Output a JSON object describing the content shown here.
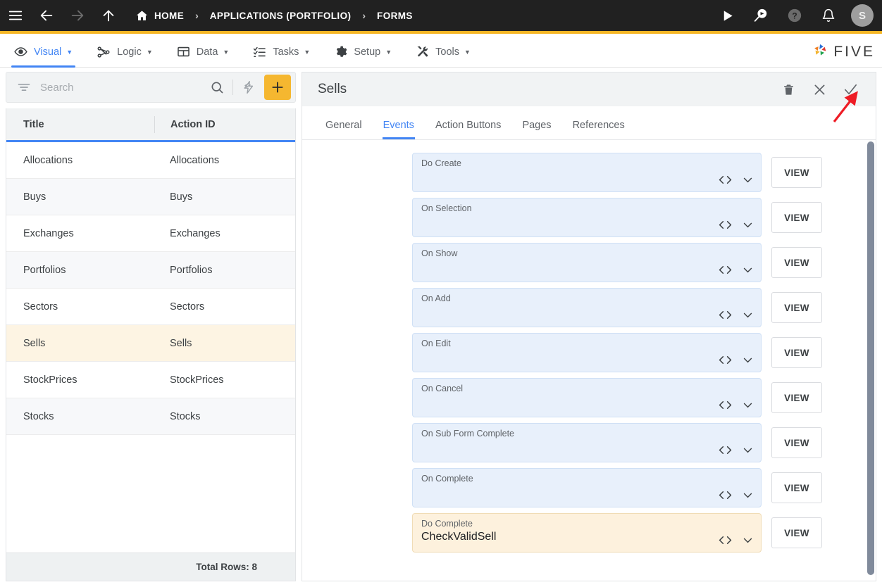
{
  "topbar": {
    "icons": [
      "menu-icon",
      "back-arrow-icon",
      "forward-arrow-icon",
      "up-arrow-icon"
    ],
    "breadcrumb": [
      {
        "label": "HOME",
        "icon": "home-icon"
      },
      {
        "label": "APPLICATIONS (PORTFOLIO)",
        "icon": ""
      },
      {
        "label": "FORMS",
        "icon": ""
      }
    ],
    "separator": "›",
    "right_icons": [
      "run-play-icon",
      "search-debug-icon",
      "help-icon",
      "notifications-bell-icon"
    ],
    "avatar_initial": "S",
    "accent_color": "#f5b625",
    "background_color": "#212121"
  },
  "navbar": {
    "items": [
      {
        "label": "Visual",
        "icon": "eye-icon",
        "active": true
      },
      {
        "label": "Logic",
        "icon": "logic-nodes-icon",
        "active": false
      },
      {
        "label": "Data",
        "icon": "table-grid-icon",
        "active": false
      },
      {
        "label": "Tasks",
        "icon": "checklist-icon",
        "active": false
      },
      {
        "label": "Setup",
        "icon": "gear-icon",
        "active": false
      },
      {
        "label": "Tools",
        "icon": "tools-icon",
        "active": false
      }
    ],
    "caret": "▼",
    "brand": "FIVE",
    "active_color": "#4285f4"
  },
  "left_panel": {
    "search": {
      "value": "",
      "placeholder": "Search"
    },
    "add_button_color": "#f5b730",
    "columns": [
      "Title",
      "Action ID"
    ],
    "rows": [
      {
        "title": "Allocations",
        "action_id": "Allocations"
      },
      {
        "title": "Buys",
        "action_id": "Buys"
      },
      {
        "title": "Exchanges",
        "action_id": "Exchanges"
      },
      {
        "title": "Portfolios",
        "action_id": "Portfolios"
      },
      {
        "title": "Sectors",
        "action_id": "Sectors"
      },
      {
        "title": "Sells",
        "action_id": "Sells"
      },
      {
        "title": "StockPrices",
        "action_id": "StockPrices"
      },
      {
        "title": "Stocks",
        "action_id": "Stocks"
      }
    ],
    "selected_row_index": 5,
    "selected_row_color": "#fdf4e3",
    "footer": "Total Rows: 8"
  },
  "right_panel": {
    "title": "Sells",
    "actions": [
      {
        "name": "delete-icon",
        "label": ""
      },
      {
        "name": "close-icon",
        "label": ""
      },
      {
        "name": "confirm-check-icon",
        "label": ""
      }
    ],
    "tabs": [
      {
        "label": "General",
        "active": false
      },
      {
        "label": "Events",
        "active": true
      },
      {
        "label": "Action Buttons",
        "active": false
      },
      {
        "label": "Pages",
        "active": false
      },
      {
        "label": "References",
        "active": false
      }
    ],
    "view_button_label": "VIEW",
    "events": [
      {
        "label": "Do Create",
        "value": "",
        "selected": false
      },
      {
        "label": "On Selection",
        "value": "",
        "selected": false
      },
      {
        "label": "On Show",
        "value": "",
        "selected": false
      },
      {
        "label": "On Add",
        "value": "",
        "selected": false
      },
      {
        "label": "On Edit",
        "value": "",
        "selected": false
      },
      {
        "label": "On Cancel",
        "value": "",
        "selected": false
      },
      {
        "label": "On Sub Form Complete",
        "value": "",
        "selected": false
      },
      {
        "label": "On Complete",
        "value": "",
        "selected": false
      },
      {
        "label": "Do Complete",
        "value": "CheckValidSell",
        "selected": true
      }
    ],
    "field_color": "#e8f0fb",
    "selected_field_color": "#fdf1dd"
  },
  "annotation": {
    "arrow_color": "#ee1c25",
    "points_to": "confirm-check-icon"
  }
}
